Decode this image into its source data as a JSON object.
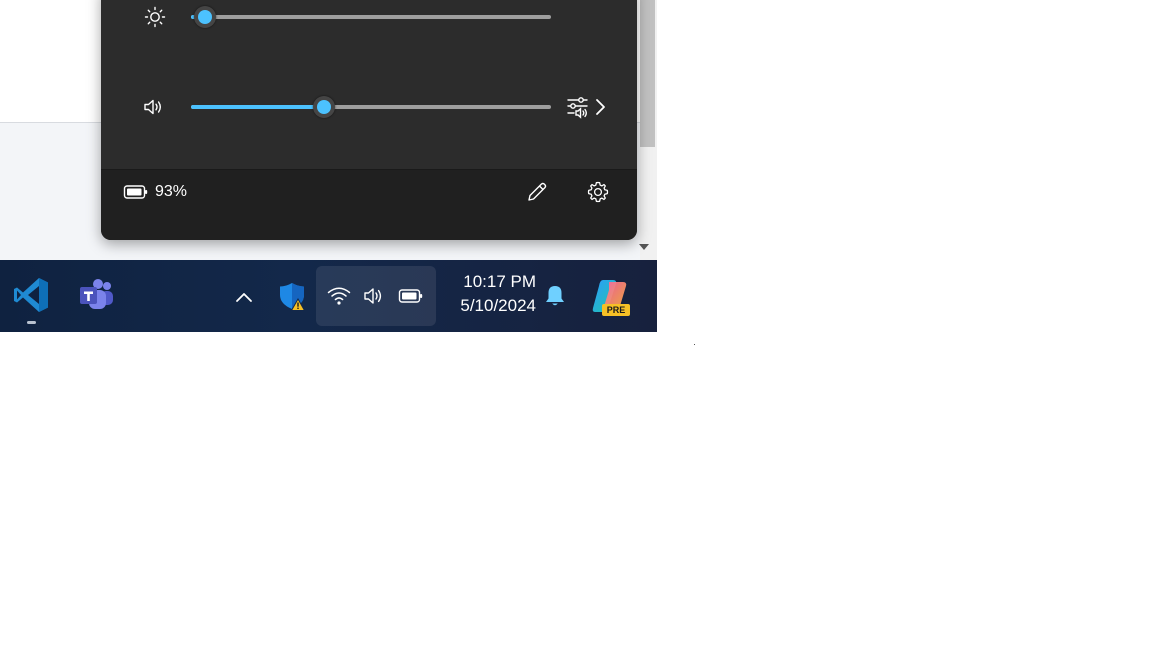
{
  "flyout": {
    "brightness": {
      "icon": "brightness-icon",
      "level_percent": 4
    },
    "volume": {
      "icon": "speaker-icon",
      "level_percent": 37,
      "mixer_icon": "audio-mixer-icon",
      "expand_icon": "chevron-right-icon"
    },
    "footer": {
      "battery_icon": "battery-icon",
      "battery_percent": "93%",
      "edit_icon": "pencil-icon",
      "settings_icon": "gear-icon"
    }
  },
  "taskbar": {
    "apps": [
      {
        "name": "Visual Studio Code",
        "icon": "vscode-icon",
        "running": true
      },
      {
        "name": "Microsoft Teams",
        "icon": "teams-icon",
        "running": false
      }
    ],
    "tray": {
      "overflow_icon": "chevron-up-icon",
      "defender_icon": "windows-security-warning-icon",
      "wifi_icon": "wifi-icon",
      "volume_icon": "speaker-icon",
      "battery_icon": "battery-icon"
    },
    "clock": {
      "time": "10:17 PM",
      "date": "5/10/2024"
    },
    "notifications_icon": "bell-icon",
    "copilot": {
      "icon": "copilot-icon",
      "badge": "PRE"
    }
  },
  "colors": {
    "accent": "#4cc2ff",
    "flyout_bg": "#2c2c2c",
    "flyout_footer_bg": "#202020",
    "taskbar_bg": "#13284a"
  }
}
